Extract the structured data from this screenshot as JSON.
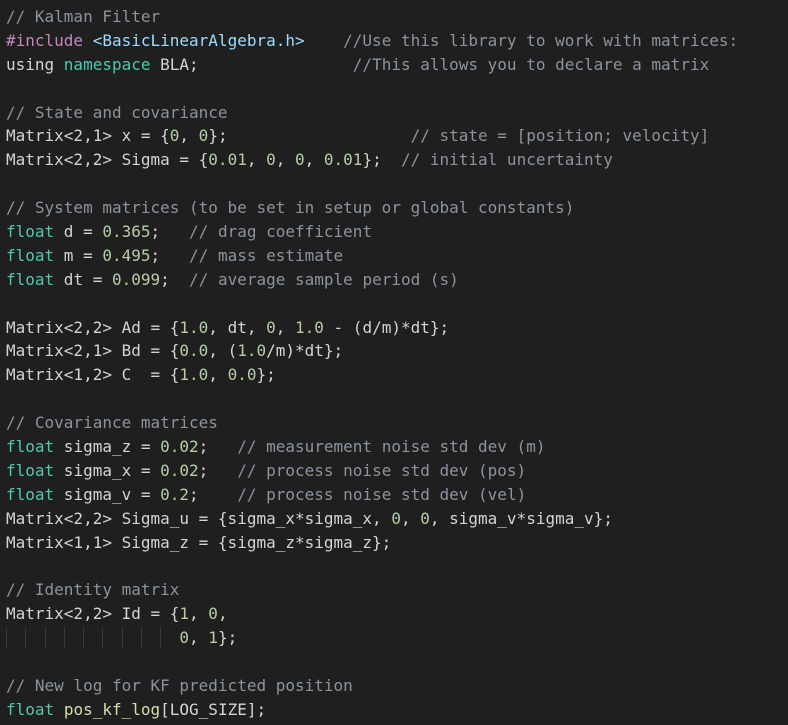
{
  "colors": {
    "background": "#1f1f1f",
    "comment": "#8b949e",
    "keyword": "#4ec9b0",
    "macro": "#c586c0",
    "string": "#9cdcfe",
    "number": "#b5cea8",
    "plain": "#d4d4d4",
    "identifier": "#dcdcaa"
  },
  "lines": [
    [
      {
        "t": "comment",
        "v": "// Kalman Filter"
      }
    ],
    [
      {
        "t": "macro",
        "v": "#include"
      },
      {
        "t": "plain",
        "v": " "
      },
      {
        "t": "string",
        "v": "<BasicLinearAlgebra.h>"
      },
      {
        "t": "plain",
        "v": "    "
      },
      {
        "t": "comment",
        "v": "//Use this library to work with matrices:"
      }
    ],
    [
      {
        "t": "plain",
        "v": "using "
      },
      {
        "t": "keyword",
        "v": "namespace"
      },
      {
        "t": "plain",
        "v": " BLA;                "
      },
      {
        "t": "comment",
        "v": "//This allows you to declare a matrix"
      }
    ],
    [],
    [
      {
        "t": "comment",
        "v": "// State and covariance"
      }
    ],
    [
      {
        "t": "plain",
        "v": "Matrix<2,1> x = {"
      },
      {
        "t": "number",
        "v": "0"
      },
      {
        "t": "plain",
        "v": ", "
      },
      {
        "t": "number",
        "v": "0"
      },
      {
        "t": "plain",
        "v": "};                   "
      },
      {
        "t": "comment",
        "v": "// state = [position; velocity]"
      }
    ],
    [
      {
        "t": "plain",
        "v": "Matrix<2,2> Sigma = {"
      },
      {
        "t": "number",
        "v": "0.01"
      },
      {
        "t": "plain",
        "v": ", "
      },
      {
        "t": "number",
        "v": "0"
      },
      {
        "t": "plain",
        "v": ", "
      },
      {
        "t": "number",
        "v": "0"
      },
      {
        "t": "plain",
        "v": ", "
      },
      {
        "t": "number",
        "v": "0.01"
      },
      {
        "t": "plain",
        "v": "};  "
      },
      {
        "t": "comment",
        "v": "// initial uncertainty"
      }
    ],
    [],
    [
      {
        "t": "comment",
        "v": "// System matrices (to be set in setup or global constants)"
      }
    ],
    [
      {
        "t": "keyword",
        "v": "float"
      },
      {
        "t": "plain",
        "v": " d = "
      },
      {
        "t": "number",
        "v": "0.365"
      },
      {
        "t": "plain",
        "v": ";   "
      },
      {
        "t": "comment",
        "v": "// drag coefficient"
      }
    ],
    [
      {
        "t": "keyword",
        "v": "float"
      },
      {
        "t": "plain",
        "v": " m = "
      },
      {
        "t": "number",
        "v": "0.495"
      },
      {
        "t": "plain",
        "v": ";   "
      },
      {
        "t": "comment",
        "v": "// mass estimate"
      }
    ],
    [
      {
        "t": "keyword",
        "v": "float"
      },
      {
        "t": "plain",
        "v": " dt = "
      },
      {
        "t": "number",
        "v": "0.099"
      },
      {
        "t": "plain",
        "v": ";  "
      },
      {
        "t": "comment",
        "v": "// average sample period (s)"
      }
    ],
    [],
    [
      {
        "t": "plain",
        "v": "Matrix<2,2> Ad = {"
      },
      {
        "t": "number",
        "v": "1.0"
      },
      {
        "t": "plain",
        "v": ", dt, "
      },
      {
        "t": "number",
        "v": "0"
      },
      {
        "t": "plain",
        "v": ", "
      },
      {
        "t": "number",
        "v": "1.0"
      },
      {
        "t": "plain",
        "v": " - (d/m)*dt};"
      }
    ],
    [
      {
        "t": "plain",
        "v": "Matrix<2,1> Bd = {"
      },
      {
        "t": "number",
        "v": "0.0"
      },
      {
        "t": "plain",
        "v": ", ("
      },
      {
        "t": "number",
        "v": "1.0"
      },
      {
        "t": "plain",
        "v": "/m)*dt};"
      }
    ],
    [
      {
        "t": "plain",
        "v": "Matrix<1,2> C  = {"
      },
      {
        "t": "number",
        "v": "1.0"
      },
      {
        "t": "plain",
        "v": ", "
      },
      {
        "t": "number",
        "v": "0.0"
      },
      {
        "t": "plain",
        "v": "};"
      }
    ],
    [],
    [
      {
        "t": "comment",
        "v": "// Covariance matrices"
      }
    ],
    [
      {
        "t": "keyword",
        "v": "float"
      },
      {
        "t": "plain",
        "v": " sigma_z = "
      },
      {
        "t": "number",
        "v": "0.02"
      },
      {
        "t": "plain",
        "v": ";   "
      },
      {
        "t": "comment",
        "v": "// measurement noise std dev (m)"
      }
    ],
    [
      {
        "t": "keyword",
        "v": "float"
      },
      {
        "t": "plain",
        "v": " sigma_x = "
      },
      {
        "t": "number",
        "v": "0.02"
      },
      {
        "t": "plain",
        "v": ";   "
      },
      {
        "t": "comment",
        "v": "// process noise std dev (pos)"
      }
    ],
    [
      {
        "t": "keyword",
        "v": "float"
      },
      {
        "t": "plain",
        "v": " sigma_v = "
      },
      {
        "t": "number",
        "v": "0.2"
      },
      {
        "t": "plain",
        "v": ";    "
      },
      {
        "t": "comment",
        "v": "// process noise std dev (vel)"
      }
    ],
    [
      {
        "t": "plain",
        "v": "Matrix<2,2> Sigma_u = {sigma_x*sigma_x, "
      },
      {
        "t": "number",
        "v": "0"
      },
      {
        "t": "plain",
        "v": ", "
      },
      {
        "t": "number",
        "v": "0"
      },
      {
        "t": "plain",
        "v": ", sigma_v*sigma_v};"
      }
    ],
    [
      {
        "t": "plain",
        "v": "Matrix<1,1> Sigma_z = {sigma_z*sigma_z};"
      }
    ],
    [],
    [
      {
        "t": "comment",
        "v": "// Identity matrix"
      }
    ],
    [
      {
        "t": "plain",
        "v": "Matrix<2,2> Id = {"
      },
      {
        "t": "number",
        "v": "1"
      },
      {
        "t": "plain",
        "v": ", "
      },
      {
        "t": "number",
        "v": "0"
      },
      {
        "t": "plain",
        "v": ","
      }
    ],
    [
      {
        "t": "plain",
        "v": "                  "
      },
      {
        "t": "number",
        "v": "0"
      },
      {
        "t": "plain",
        "v": ", "
      },
      {
        "t": "number",
        "v": "1"
      },
      {
        "t": "plain",
        "v": "};"
      }
    ],
    [],
    [
      {
        "t": "comment",
        "v": "// New log for KF predicted position"
      }
    ],
    [
      {
        "t": "keyword",
        "v": "float"
      },
      {
        "t": "plain",
        "v": " "
      },
      {
        "t": "ident",
        "v": "pos_kf_log"
      },
      {
        "t": "plain",
        "v": "[LOG_SIZE];"
      }
    ]
  ]
}
